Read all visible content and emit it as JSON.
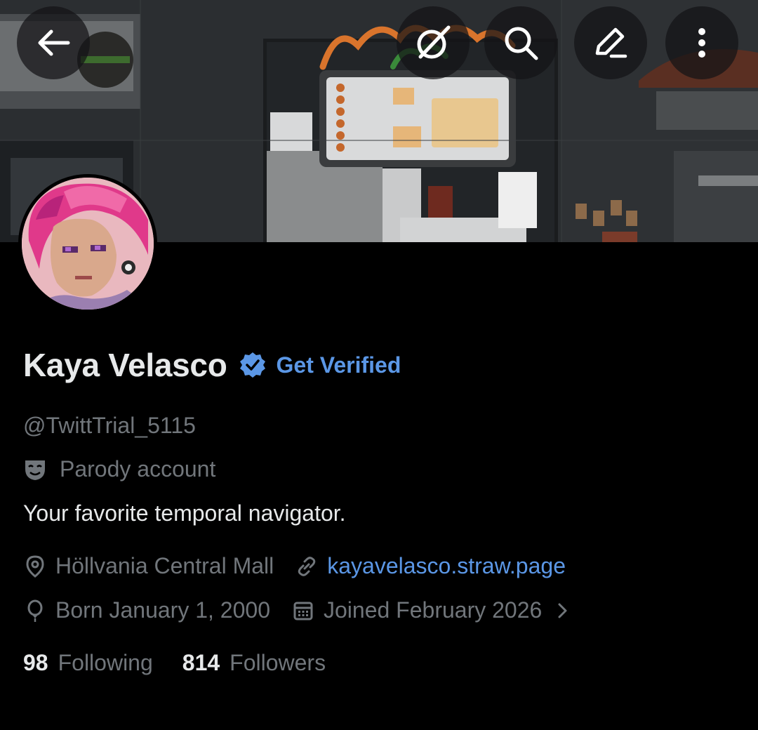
{
  "header": {
    "back_icon": "arrow-left-icon",
    "grok_icon": "grok-slash-icon",
    "search_icon": "search-icon",
    "edit_icon": "edit-pencil-icon",
    "more_icon": "more-vertical-icon"
  },
  "profile": {
    "display_name": "Kaya Velasco",
    "get_verified_label": "Get Verified",
    "handle": "@TwittTrial_5115",
    "parody_label": "Parody account",
    "bio": "Your favorite temporal navigator.",
    "location": "Höllvania Central Mall",
    "website": "kayavelasco.straw.page",
    "birthday": "Born January 1, 2000",
    "joined": "Joined February 2026",
    "following_count": "98",
    "following_label": "Following",
    "followers_count": "814",
    "followers_label": "Followers"
  },
  "colors": {
    "background": "#000000",
    "primary_text": "#e7e9ea",
    "secondary_text": "#71767b",
    "accent": "#5b97e6",
    "verified_badge": "#5b97e6"
  }
}
